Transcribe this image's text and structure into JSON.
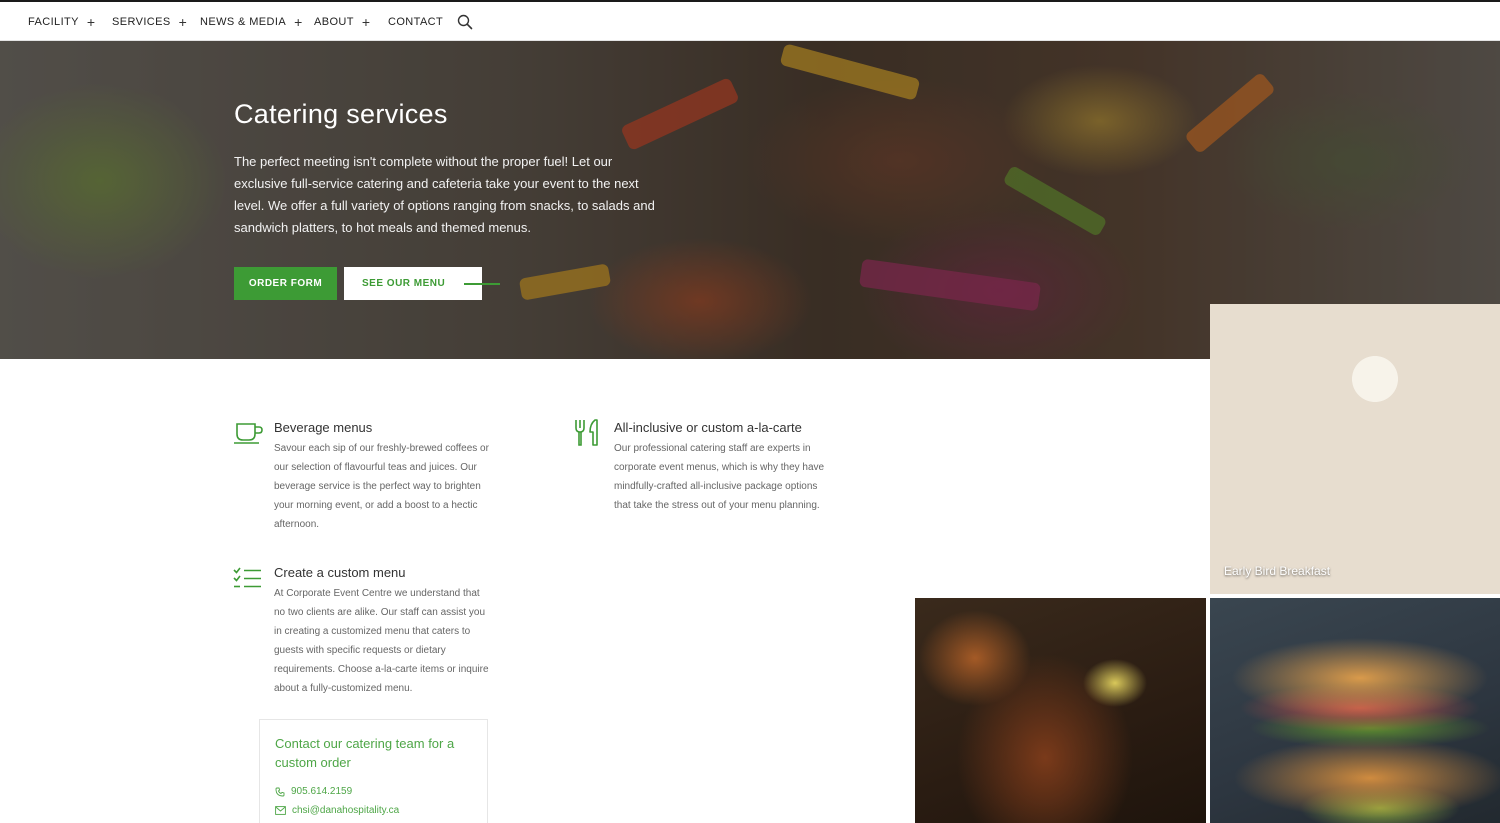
{
  "nav": {
    "items": [
      {
        "label": "FACILITY",
        "has_submenu": true
      },
      {
        "label": "SERVICES",
        "has_submenu": true
      },
      {
        "label": "NEWS & MEDIA",
        "has_submenu": true
      },
      {
        "label": "ABOUT",
        "has_submenu": true
      },
      {
        "label": "CONTACT",
        "has_submenu": false
      }
    ],
    "plus_glyph": "+",
    "search_icon": "search-icon"
  },
  "hero": {
    "title": "Catering services",
    "text": "The perfect meeting isn't complete without the proper fuel! Let our exclusive full-service catering and cafeteria take your event to the next level. We offer a full variety of options ranging from snacks, to salads and sandwich platters, to hot meals and themed menus.",
    "order_button": "ORDER FORM",
    "menu_button": "SEE OUR MENU"
  },
  "features": [
    {
      "icon": "coffee-cup-icon",
      "title": "Beverage menus",
      "body": "Savour each sip of our freshly-brewed coffees or our selection of flavourful teas and juices. Our beverage service is the perfect way to brighten your morning event, or add a boost to a hectic afternoon."
    },
    {
      "icon": "fork-knife-icon",
      "title": "All-inclusive or custom a-la-carte",
      "body": "Our professional catering staff are experts in corporate event menus, which is why they have mindfully-crafted all-inclusive package options that take the stress out of your menu planning."
    },
    {
      "icon": "checklist-icon",
      "title": "Create a custom menu",
      "body": "At Corporate Event Centre we understand that no two clients are alike. Our staff can assist you in creating a customized menu that caters to guests with specific requests or dietary requirements. Choose a-la-carte items or inquire about a fully-customized menu."
    }
  ],
  "contact": {
    "title": "Contact our catering team for a custom order",
    "phone": "905.614.2159",
    "email": "chsi@danahospitality.ca"
  },
  "tiles": [
    {
      "caption": "Early Bird Breakfast"
    }
  ],
  "colors": {
    "accent": "#3d9b35",
    "accent_light": "#4ea647",
    "text": "#333333",
    "muted": "#666666"
  }
}
